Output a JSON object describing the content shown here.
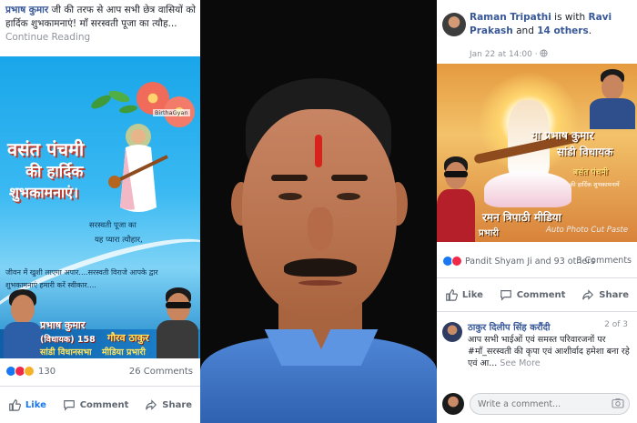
{
  "left_post": {
    "author": "प्रभाष कुमार",
    "text": " जी की तरफ से आप सभी छेत्र वासियों को हार्दिक शुभकामनाएं! माँ सरस्वती पूजा का त्यौह...",
    "continue": "Continue Reading",
    "image": {
      "watermark": "BirthaGyan",
      "heading_line1": "वसंत पंचमी",
      "heading_line2": "की हार्दिक",
      "heading_line3": "शुभकामनाएं।",
      "poem1": "सरस्वती पूजा का",
      "poem2": "यह प्यारा त्यौहार,",
      "poem3": "",
      "poem4": "जीवन में खुशी लाएगा अपार....सरस्वती विराजे आपके द्वार",
      "poem5": "शुभकामनाएं हमारी करें स्वीकार....",
      "name1": "प्रभाष कुमार",
      "name1_sub": "(विधायक) 158",
      "name1_sub2": "सांडी विधानसभा",
      "name2": "गौरव ठाकुर",
      "name2_sub": "मीडिया प्रभारी"
    },
    "reactions_count": "130",
    "comments_count": "26 Comments",
    "actions": {
      "like": "Like",
      "comment": "Comment",
      "share": "Share"
    }
  },
  "right_post": {
    "author": "Raman Tripathi",
    "with_text": " is with ",
    "tag1": "Ravi Prakash",
    "and_text": " and ",
    "tag2": "14 others",
    "tail": ".",
    "time": "Jan 22 at 14:00 · ",
    "image": {
      "title_line1": "मा प्रभाष कुमार",
      "title_line2": "सांडी विधायक",
      "sub1": "बसंत पंचमी",
      "sub2": "की हार्दिक शुभकामनायें",
      "bottom1": "रमन त्रिपाठी मीडिया",
      "bottom2": "प्रभारी",
      "watermark": "Auto Photo Cut Paste"
    },
    "reactions_text": "Pandit Shyam Ji and 93 others",
    "comments_count": "3 Comments",
    "actions": {
      "like": "Like",
      "comment": "Comment",
      "share": "Share"
    },
    "comment": {
      "author": "ठाकुर दिलीप सिंह करौंदी",
      "page": "2 of 3",
      "text": "आप सभी भाईओं एवं समस्त परिवारजनों पर #माँ_सरस्वती की कृपा एवं आशीर्वाद हमेशा बना रहे एवं आ...",
      "see_more": " See More"
    },
    "write_placeholder": "Write a comment..."
  },
  "colors": {
    "facebook_blue": "#385898",
    "like_blue": "#1877f2",
    "muted_gray": "#606770"
  }
}
